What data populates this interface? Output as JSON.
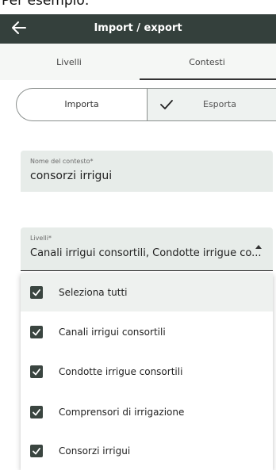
{
  "caption": "Per esempio:",
  "appbar": {
    "title": "Import / export",
    "back_icon": "arrow-left-icon"
  },
  "tabs": [
    {
      "label": "Livelli"
    },
    {
      "label": "Contesti",
      "active": true
    }
  ],
  "segment": {
    "import_label": "Importa",
    "export_label": "Esporta",
    "selected": "Esporta",
    "check_icon": "checkmark-icon"
  },
  "context_name": {
    "label": "Nome del contesto*",
    "value": "consorzi irrigui"
  },
  "levels": {
    "label": "Livelli*",
    "value": "Canali irrigui consortili, Condotte irrigue co...",
    "options": [
      {
        "label": "Seleziona tutti",
        "checked": true
      },
      {
        "label": "Canali irrigui consortili",
        "checked": true
      },
      {
        "label": "Condotte irrigue consortili",
        "checked": true
      },
      {
        "label": "Comprensori di irrigazione",
        "checked": true
      },
      {
        "label": "Consorzi irrigui",
        "checked": true
      }
    ]
  },
  "colors": {
    "appbar": "#34403c",
    "checkbox": "#3a4540",
    "field_bg": "#e7ece9"
  }
}
